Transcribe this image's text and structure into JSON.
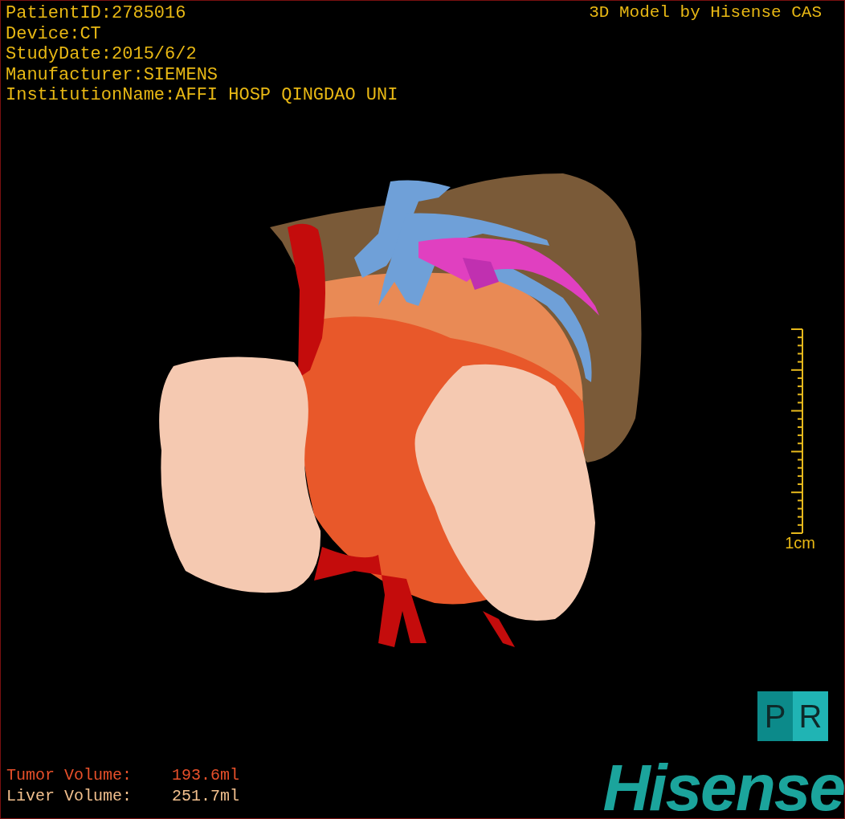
{
  "study_info": [
    "PatientID:2785016",
    "Device:CT",
    "StudyDate:2015/6/2",
    "Manufacturer:SIEMENS",
    "InstitutionName:AFFI HOSP QINGDAO UNI"
  ],
  "credit": "3D Model by Hisense CAS",
  "scale": {
    "label": "1cm"
  },
  "pr_button": {
    "letters": [
      "P",
      "R"
    ]
  },
  "volumes": [
    {
      "label": "Tumor Volume:",
      "value": "193.6ml",
      "color": "#e8502a"
    },
    {
      "label": "Liver Volume:",
      "value": "251.7ml",
      "color": "#f2c08e"
    }
  ],
  "logo": "Hisense"
}
